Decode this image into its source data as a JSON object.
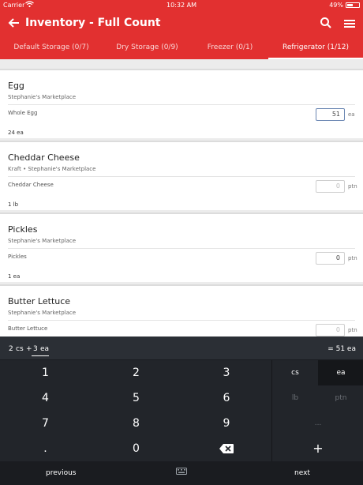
{
  "status": {
    "carrier": "Carrier",
    "time": "10:32 AM",
    "battery": "49%",
    "battery_level": 0.49
  },
  "header": {
    "title": "Inventory - Full Count"
  },
  "tabs": [
    {
      "label": "Default Storage (0/7)"
    },
    {
      "label": "Dry Storage (0/9)"
    },
    {
      "label": "Freezer (0/1)"
    },
    {
      "label": "Refrigerator (1/12)"
    }
  ],
  "items": [
    {
      "name": "Egg",
      "subtitle": "Stephanie's Marketplace",
      "item_label": "Whole Egg",
      "value": "51",
      "unit": "ea",
      "total": "24 ea"
    },
    {
      "name": "Cheddar Cheese",
      "subtitle": "Kraft • Stephanie's Marketplace",
      "item_label": "Cheddar Cheese",
      "value": "0",
      "unit": "ptn",
      "total": "1 lb"
    },
    {
      "name": "Pickles",
      "subtitle": "Stephanie's Marketplace",
      "item_label": "Pickles",
      "value": "0",
      "unit": "ptn",
      "total": "1 ea"
    },
    {
      "name": "Butter Lettuce",
      "subtitle": "Stephanie's Marketplace",
      "item_label": "Butter Lettuce",
      "value": "0",
      "unit": "ptn",
      "total": ""
    }
  ],
  "keypad": {
    "expression": [
      "2",
      "cs",
      "+",
      "3",
      "ea"
    ],
    "result": "= 51 ea",
    "digits": [
      "1",
      "2",
      "3",
      "4",
      "5",
      "6",
      "7",
      "8",
      "9",
      ".",
      "0"
    ],
    "units": [
      "cs",
      "ea",
      "lb",
      "ptn",
      "...",
      "+"
    ],
    "previous": "previous",
    "next": "next"
  }
}
